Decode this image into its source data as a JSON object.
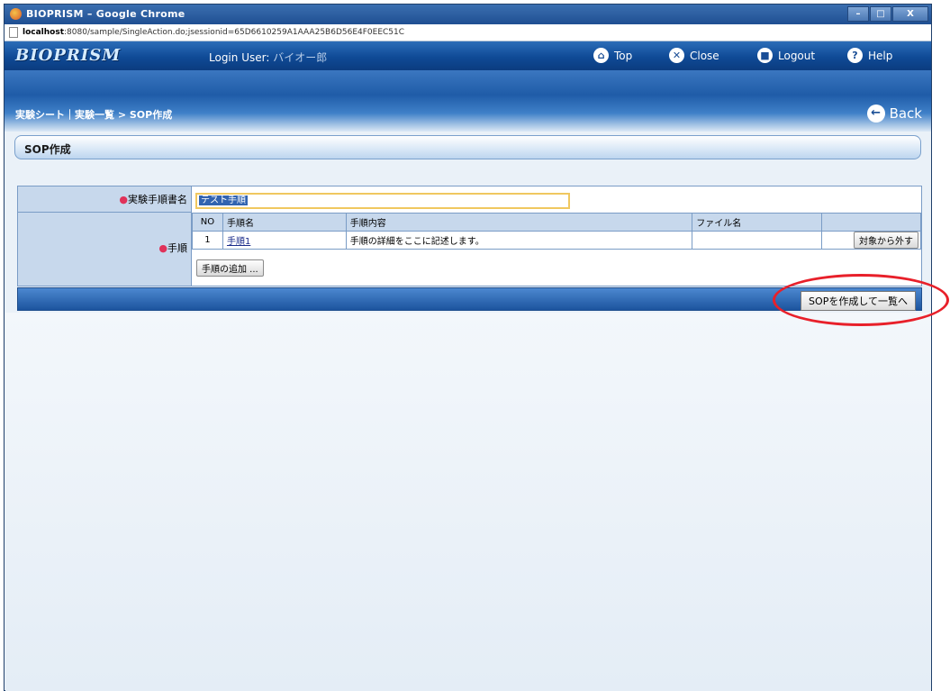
{
  "browser": {
    "window_title": "BIOPRISM – Google Chrome",
    "url_host": "localhost",
    "url_rest": ":8080/sample/SingleAction.do;jsessionid=65D6610259A1AAA25B6D56E4F0EEC51C",
    "minimize": "–",
    "maximize": "□",
    "close": "X"
  },
  "header": {
    "logo": "BIOPRISM",
    "login_label": "Login User:",
    "login_user": "バイオー郎",
    "nav": [
      {
        "label": "Top",
        "icon": "home-icon"
      },
      {
        "label": "Close",
        "icon": "close-circle-icon"
      },
      {
        "label": "Logout",
        "icon": "logout-icon"
      },
      {
        "label": "Help",
        "icon": "help-icon"
      }
    ]
  },
  "breadcrumb": {
    "text": "実験シート｜実験一覧 > SOP作成",
    "back_label": "Back"
  },
  "section": {
    "title": "SOP作成"
  },
  "form": {
    "sop_name_label": "実験手順書名",
    "sop_name_value": "テスト手順",
    "steps_label": "手順",
    "columns": [
      "NO",
      "手順名",
      "手順内容",
      "ファイル名",
      ""
    ],
    "rows": [
      {
        "no": "1",
        "name": "手順1",
        "content": "手順の詳細をここに記述します。",
        "file": "",
        "remove_label": "対象から外す"
      }
    ],
    "add_step_label": "手順の追加 ..."
  },
  "actions": {
    "create_label": "SOPを作成して一覧へ"
  },
  "colors": {
    "header_blue": "#0f4a96",
    "highlight_red": "#e8202a",
    "required_mark": "#e0325a"
  }
}
